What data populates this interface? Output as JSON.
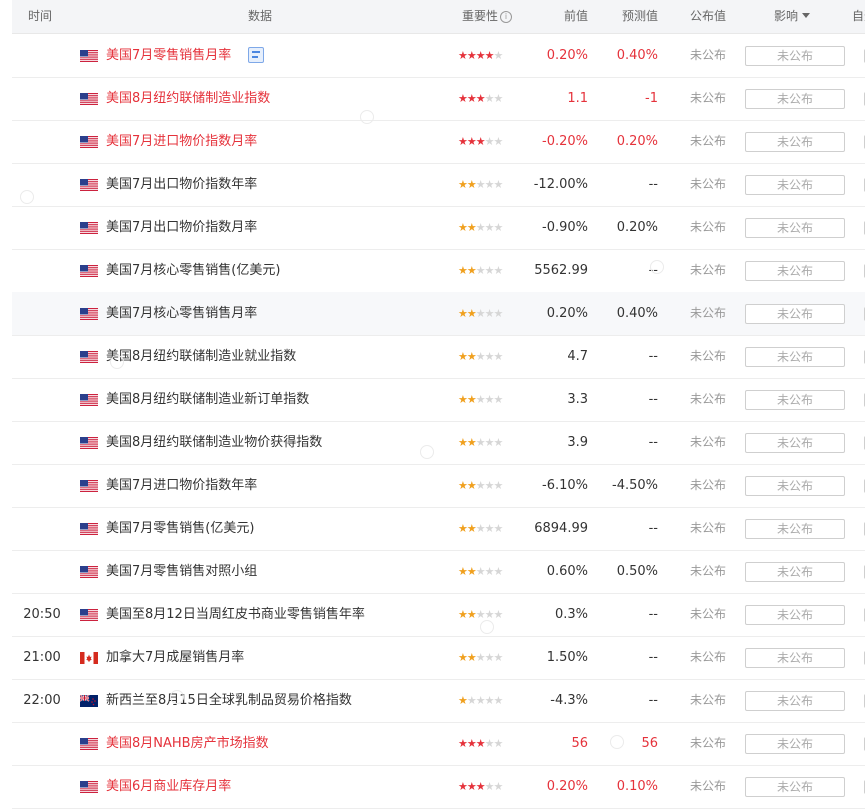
{
  "header": {
    "time": "时间",
    "data": "数据",
    "importance": "重要性",
    "info_icon": "i",
    "previous": "前值",
    "forecast": "预测值",
    "actual": "公布值",
    "impact": "影响",
    "custom": "自选"
  },
  "rows": [
    {
      "time": "",
      "country": "us",
      "name": "美国7月零售销售月率",
      "red": true,
      "stars": 4,
      "prev": "0.20%",
      "forecast": "0.40%",
      "actual": "未公布",
      "impact": "未公布",
      "doc": true
    },
    {
      "time": "",
      "country": "us",
      "name": "美国8月纽约联储制造业指数",
      "red": true,
      "stars": 3,
      "prev": "1.1",
      "forecast": "-1",
      "actual": "未公布",
      "impact": "未公布"
    },
    {
      "time": "",
      "country": "us",
      "name": "美国7月进口物价指数月率",
      "red": true,
      "stars": 3,
      "prev": "-0.20%",
      "forecast": "0.20%",
      "actual": "未公布",
      "impact": "未公布"
    },
    {
      "time": "",
      "country": "us",
      "name": "美国7月出口物价指数年率",
      "red": false,
      "stars": 2,
      "prev": "-12.00%",
      "forecast": "--",
      "actual": "未公布",
      "impact": "未公布"
    },
    {
      "time": "",
      "country": "us",
      "name": "美国7月出口物价指数月率",
      "red": false,
      "stars": 2,
      "prev": "-0.90%",
      "forecast": "0.20%",
      "actual": "未公布",
      "impact": "未公布"
    },
    {
      "time": "",
      "country": "us",
      "name": "美国7月核心零售销售(亿美元)",
      "red": false,
      "stars": 2,
      "prev": "5562.99",
      "forecast": "--",
      "actual": "未公布",
      "impact": "未公布"
    },
    {
      "time": "",
      "country": "us",
      "name": "美国7月核心零售销售月率",
      "red": false,
      "stars": 2,
      "prev": "0.20%",
      "forecast": "0.40%",
      "actual": "未公布",
      "impact": "未公布",
      "highlight": true
    },
    {
      "time": "",
      "country": "us",
      "name": "美国8月纽约联储制造业就业指数",
      "red": false,
      "stars": 2,
      "prev": "4.7",
      "forecast": "--",
      "actual": "未公布",
      "impact": "未公布"
    },
    {
      "time": "",
      "country": "us",
      "name": "美国8月纽约联储制造业新订单指数",
      "red": false,
      "stars": 2,
      "prev": "3.3",
      "forecast": "--",
      "actual": "未公布",
      "impact": "未公布"
    },
    {
      "time": "",
      "country": "us",
      "name": "美国8月纽约联储制造业物价获得指数",
      "red": false,
      "stars": 2,
      "prev": "3.9",
      "forecast": "--",
      "actual": "未公布",
      "impact": "未公布"
    },
    {
      "time": "",
      "country": "us",
      "name": "美国7月进口物价指数年率",
      "red": false,
      "stars": 2,
      "prev": "-6.10%",
      "forecast": "-4.50%",
      "actual": "未公布",
      "impact": "未公布"
    },
    {
      "time": "",
      "country": "us",
      "name": "美国7月零售销售(亿美元)",
      "red": false,
      "stars": 2,
      "prev": "6894.99",
      "forecast": "--",
      "actual": "未公布",
      "impact": "未公布"
    },
    {
      "time": "",
      "country": "us",
      "name": "美国7月零售销售对照小组",
      "red": false,
      "stars": 2,
      "prev": "0.60%",
      "forecast": "0.50%",
      "actual": "未公布",
      "impact": "未公布"
    },
    {
      "time": "20:50",
      "country": "us",
      "name": "美国至8月12日当周红皮书商业零售销售年率",
      "red": false,
      "stars": 2,
      "prev": "0.3%",
      "forecast": "--",
      "actual": "未公布",
      "impact": "未公布"
    },
    {
      "time": "21:00",
      "country": "ca",
      "name": "加拿大7月成屋销售月率",
      "red": false,
      "stars": 2,
      "prev": "1.50%",
      "forecast": "--",
      "actual": "未公布",
      "impact": "未公布"
    },
    {
      "time": "22:00",
      "country": "nz",
      "name": "新西兰至8月15日全球乳制品贸易价格指数",
      "red": false,
      "stars": 1,
      "prev": "-4.3%",
      "forecast": "--",
      "actual": "未公布",
      "impact": "未公布"
    },
    {
      "time": "",
      "country": "us",
      "name": "美国8月NAHB房产市场指数",
      "red": true,
      "stars": 3,
      "prev": "56",
      "forecast": "56",
      "actual": "未公布",
      "impact": "未公布"
    },
    {
      "time": "",
      "country": "us",
      "name": "美国6月商业库存月率",
      "red": true,
      "stars": 3,
      "prev": "0.20%",
      "forecast": "0.10%",
      "actual": "未公布",
      "impact": "未公布"
    }
  ],
  "colors": {
    "accent_red": "#e5323b",
    "star_orange": "#f0a01e",
    "star_grey": "#d6d6d6"
  }
}
